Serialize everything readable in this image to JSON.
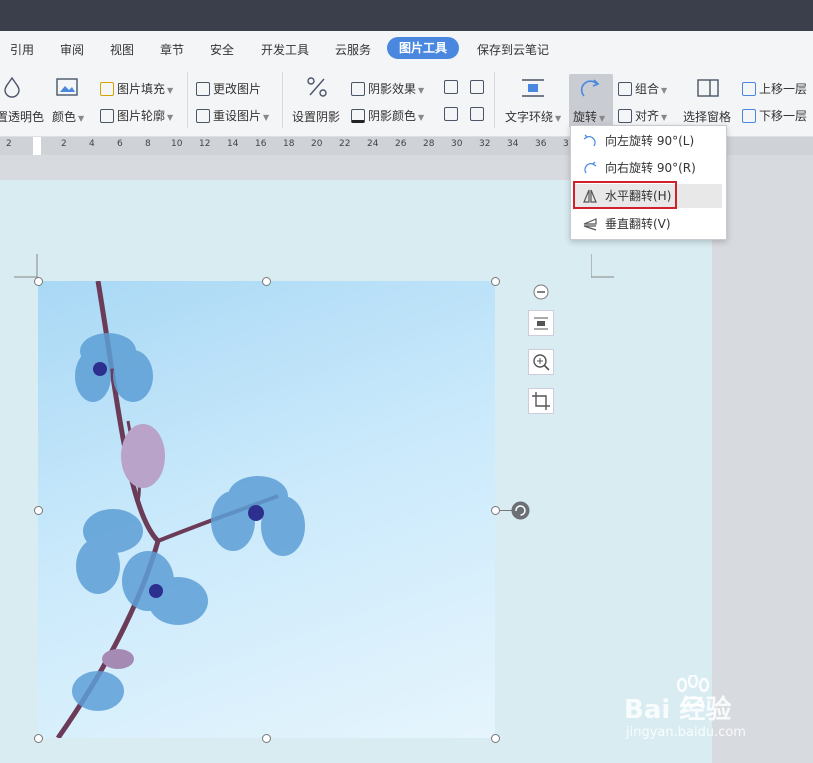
{
  "tabs": [
    "引用",
    "审阅",
    "视图",
    "章节",
    "安全",
    "开发工具",
    "云服务",
    "图片工具",
    "保存到云笔记"
  ],
  "ribbon": {
    "set_transparent": "置透明色",
    "color": "颜色",
    "picture_fill": "图片填充",
    "picture_outline": "图片轮廓",
    "change_picture": "更改图片",
    "reset_picture": "重设图片",
    "set_shadow": "设置阴影",
    "shadow_effect": "阴影效果",
    "shadow_color": "阴影颜色",
    "text_wrap": "文字环绕",
    "rotate": "旋转",
    "group": "组合",
    "align": "对齐",
    "selection_pane": "选择窗格",
    "bring_forward": "上移一层",
    "send_backward": "下移一层"
  },
  "ruler": [
    "2",
    "2",
    "4",
    "6",
    "8",
    "10",
    "12",
    "14",
    "16",
    "18",
    "20",
    "22",
    "24",
    "26",
    "28",
    "30",
    "32",
    "34",
    "36",
    "3"
  ],
  "rotate_menu": [
    {
      "label": "向左旋转 90°(L)",
      "icon": "rotate-left-icon"
    },
    {
      "label": "向右旋转 90°(R)",
      "icon": "rotate-right-icon"
    },
    {
      "label": "水平翻转(H)",
      "icon": "flip-horizontal-icon"
    },
    {
      "label": "垂直翻转(V)",
      "icon": "flip-vertical-icon"
    }
  ],
  "watermark": {
    "brand": "Bai  经验",
    "url": "jingyan.baidu.com"
  },
  "colors": {
    "accent": "#4a88e0",
    "highlight": "#d0202a",
    "titlebar": "#3a3f4b"
  }
}
